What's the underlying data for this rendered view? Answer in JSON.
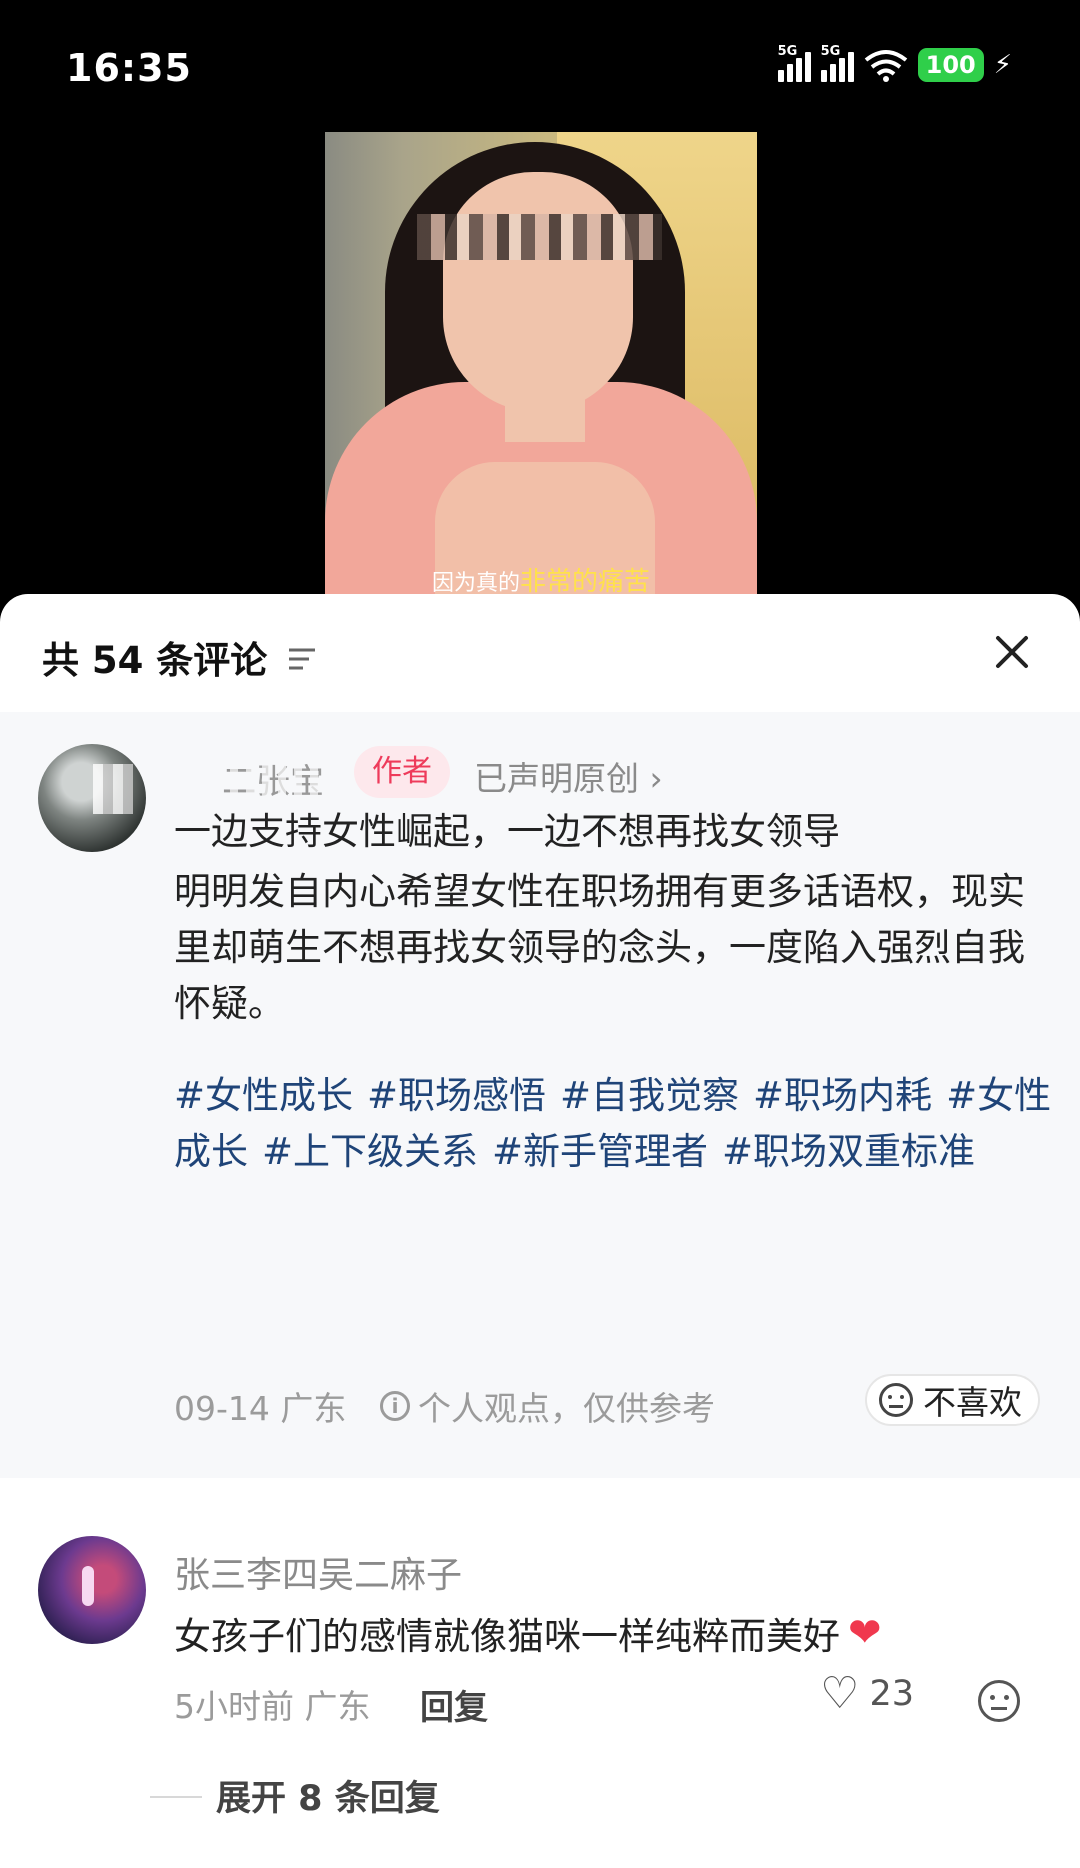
{
  "status_bar": {
    "time": "16:35",
    "network_1": "5G",
    "network_2": "5G",
    "battery": "100"
  },
  "video": {
    "caption_prefix": "因为真的",
    "caption_highlight": "非常的痛苦"
  },
  "comments_panel": {
    "title": "共 54 条评论",
    "author_post": {
      "author_name": "二张宝",
      "author_badge": "作者",
      "original_label": "已声明原创 ›",
      "title": "一边支持女性崛起，一边不想再找女领导",
      "body": "明明发自内心希望女性在职场拥有更多话语权，现实里却萌生不想再找女领导的念头，一度陷入强烈自我怀疑。",
      "tags": [
        "#女性成长",
        "#职场感悟",
        "#自我觉察",
        "#职场内耗",
        "#女性成长",
        "#上下级关系",
        "#新手管理者",
        "#职场双重标准"
      ],
      "date_location": "09-14 广东",
      "notice": "个人观点，仅供参考",
      "dislike_label": "不喜欢"
    },
    "comments": [
      {
        "username": "张三李四吴二麻子",
        "text": "女孩子们的感情就像猫咪一样纯粹而美好",
        "time_location": "5小时前 广东",
        "reply_label": "回复",
        "likes": "23",
        "expand_label": "展开 8 条回复"
      }
    ]
  }
}
